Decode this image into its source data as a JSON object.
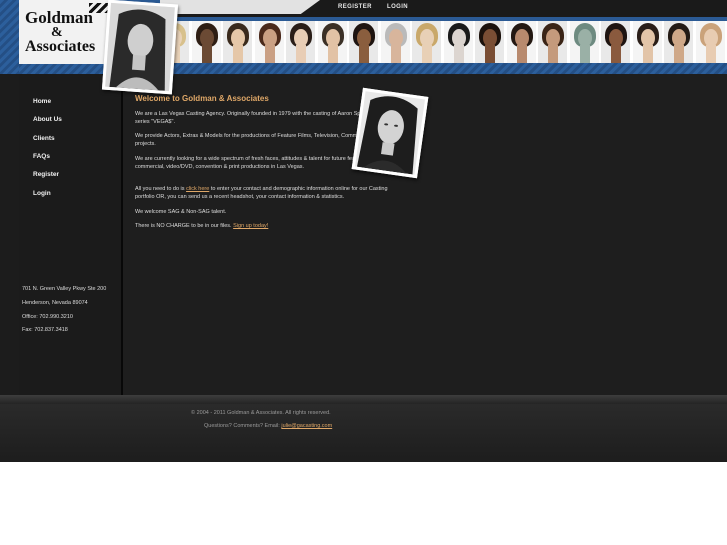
{
  "header": {
    "logo_line1": "Goldman",
    "logo_line2": "&",
    "logo_line3": "Associates",
    "nav": {
      "register": "REGISTER",
      "login": "LOGIN"
    },
    "thumb_colors": [
      {
        "skin": "#e9d2b8",
        "hair": "#d8c18c"
      },
      {
        "skin": "#6b4a34",
        "hair": "#2e1e14"
      },
      {
        "skin": "#e5c7a8",
        "hair": "#3a2a1c"
      },
      {
        "skin": "#caa084",
        "hair": "#4b2a1c"
      },
      {
        "skin": "#e8cdb5",
        "hair": "#2a1e18"
      },
      {
        "skin": "#e2c2a5",
        "hair": "#3b3026"
      },
      {
        "skin": "#8a5e3e",
        "hair": "#1e1410"
      },
      {
        "skin": "#d8b59c",
        "hair": "#bababa"
      },
      {
        "skin": "#e8d0b6",
        "hair": "#c9a86a"
      },
      {
        "skin": "#dcd5d0",
        "hair": "#1a1a1a"
      },
      {
        "skin": "#7a4e34",
        "hair": "#1c120c"
      },
      {
        "skin": "#b88a6e",
        "hair": "#241812"
      },
      {
        "skin": "#c49a7c",
        "hair": "#3a2416"
      },
      {
        "skin": "#9ab0a6",
        "hair": "#6d8a80"
      },
      {
        "skin": "#8a5a3e",
        "hair": "#1e1410"
      },
      {
        "skin": "#e2c4a8",
        "hair": "#2a1e18"
      },
      {
        "skin": "#cfa888",
        "hair": "#231a14"
      },
      {
        "skin": "#e8ccb2",
        "hair": "#caa27a"
      }
    ]
  },
  "sidebar": {
    "items": [
      "Home",
      "About Us",
      "Clients",
      "FAQs",
      "Register",
      "Login"
    ],
    "address": [
      "701 N. Green Valley Pkwy Ste 200",
      "Henderson, Nevada 89074",
      "Office: 702.990.3210",
      "Fax: 702.837.3418"
    ]
  },
  "content": {
    "title": "Welcome to Goldman & Associates",
    "p1": "We are a Las Vegas Casting Agency. Originally founded in 1979 with the casting of Aaron Spelling's television series \"VEGA$\".",
    "p2": "We provide Actors, Extras & Models for the productions of Feature Films, Television, Commercial, & Print projects.",
    "p3": "We are currently looking for a wide spectrum of fresh faces, attitudes & talent for future feature films, television, commercial, video/DVD, convention & print productions in Las Vegas.",
    "p4_before": "All you need to do is ",
    "p4_link": "click here",
    "p4_after": " to enter your contact and demographic information online for our Casting portfolio OR, you can send us a recent headshot, your contact information & statistics.",
    "p5": "We welcome SAG & Non-SAG talent.",
    "p6_before": "There is NO CHARGE to be in our files. ",
    "p6_link": "Sign up today!"
  },
  "footer": {
    "copyright": "© 2004 - 2011 Goldman & Associates.  All rights reserved.",
    "questions_before": "Questions? Comments? Email: ",
    "email": "julie@gacasting.com"
  },
  "colors": {
    "accent": "#e0a868",
    "header_blue": "#2b5a94"
  }
}
